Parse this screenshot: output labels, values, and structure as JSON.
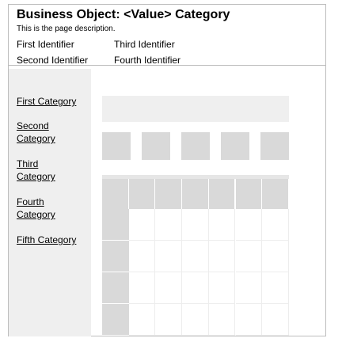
{
  "page": {
    "title": "Business Object: <Value> Category",
    "description": "This is the page description."
  },
  "identifiers": [
    "First Identifier",
    "Third Identifier",
    "Second Identifier",
    "Fourth Identifier"
  ],
  "categories": [
    {
      "lines": [
        "First Category"
      ]
    },
    {
      "lines": [
        "Second",
        "Category"
      ]
    },
    {
      "lines": [
        "Third",
        "Category"
      ]
    },
    {
      "lines": [
        "Fourth",
        "Category"
      ]
    },
    {
      "lines": [
        "Fifth Category"
      ]
    }
  ],
  "colors": {
    "sidebar_bg": "#efefef",
    "placeholder_dark": "#d9d9d9",
    "border": "#bdbdbd"
  }
}
